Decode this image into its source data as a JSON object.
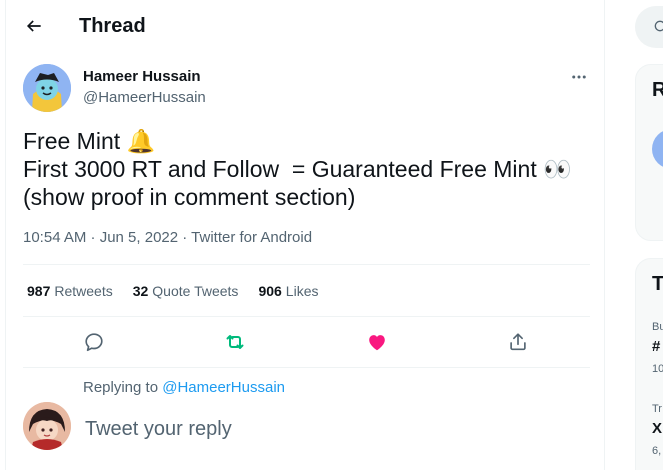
{
  "header": {
    "title": "Thread"
  },
  "tweet": {
    "author_name": "Hameer Hussain",
    "author_handle": "@HameerHussain",
    "lines": [
      "Free Mint 🔔",
      "First 3000 RT and Follow  = Guaranteed Free Mint 👀",
      "(show proof in comment section)"
    ],
    "timestamp": "10:54 AM · Jun 5, 2022 · Twitter for Android"
  },
  "stats": {
    "retweets_count": "987",
    "retweets_label": "Retweets",
    "quotes_count": "32",
    "quotes_label": "Quote Tweets",
    "likes_count": "906",
    "likes_label": "Likes"
  },
  "reply": {
    "replying_to_prefix": "Replying to",
    "replying_to_handle": "@HameerHussain",
    "placeholder": "Tweet your reply"
  },
  "sidebar": {
    "card1_head": "R",
    "card2_head": "T",
    "trend1_context": "Bu",
    "trend1_topic": "#",
    "trend1_count": "10",
    "trend2_context": "Tr",
    "trend2_topic": "X",
    "trend2_count": "6,"
  },
  "colors": {
    "accent": "#1d9bf0",
    "retweet_active": "#00ba7c",
    "like_active": "#f91880",
    "secondary_text": "#536471"
  },
  "icons": {
    "back": "arrow-left-icon",
    "more": "more-icon",
    "reply": "reply-icon",
    "retweet": "retweet-icon",
    "like": "heart-icon",
    "share": "share-icon",
    "search": "search-icon"
  }
}
